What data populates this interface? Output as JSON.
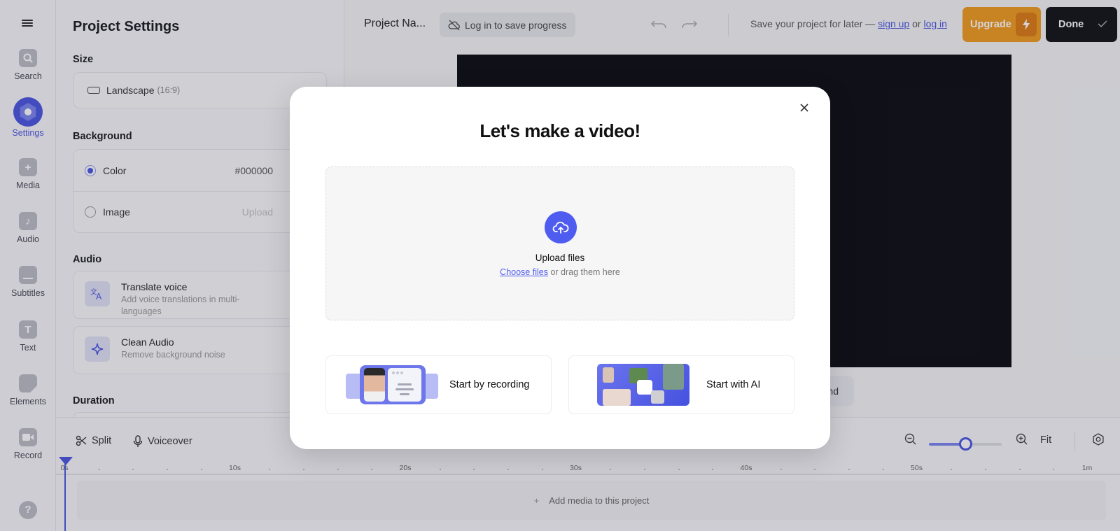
{
  "rail": {
    "menu_icon": "hamburger-icon",
    "items": [
      {
        "label": "Search",
        "icon": "search-icon",
        "active": false
      },
      {
        "label": "Settings",
        "icon": "settings-icon",
        "active": true
      },
      {
        "label": "Media",
        "icon": "plus-icon",
        "active": false
      },
      {
        "label": "Audio",
        "icon": "music-note-icon",
        "active": false
      },
      {
        "label": "Subtitles",
        "icon": "subtitles-icon",
        "active": false
      },
      {
        "label": "Text",
        "icon": "text-icon",
        "active": false
      },
      {
        "label": "Elements",
        "icon": "sticker-icon",
        "active": false
      },
      {
        "label": "Record",
        "icon": "camera-icon",
        "active": false
      }
    ],
    "help_label": "?"
  },
  "panel": {
    "title": "Project Settings",
    "size": {
      "heading": "Size",
      "value": "Landscape",
      "ratio": "(16:9)"
    },
    "background": {
      "heading": "Background",
      "options": [
        {
          "label": "Color",
          "value": "#000000",
          "selected": true
        },
        {
          "label": "Image",
          "value": "Upload",
          "selected": false
        }
      ]
    },
    "audio": {
      "heading": "Audio",
      "items": [
        {
          "title": "Translate voice",
          "description": "Add voice translations in multi-languages",
          "icon": "translate-icon"
        },
        {
          "title": "Clean Audio",
          "description": "Remove background noise",
          "icon": "sparkle-icon"
        }
      ]
    },
    "duration": {
      "heading": "Duration"
    }
  },
  "topbar": {
    "project_name": "Project Na...",
    "save_progress": "Log in to save progress",
    "save_later_prefix": "Save your project for later —",
    "sign_up": "sign up",
    "or": "or",
    "log_in": "log in",
    "upgrade": "Upgrade",
    "done": "Done"
  },
  "canvas": {
    "background_color": "#000000",
    "background_button_partial": "nd"
  },
  "bottom": {
    "split": "Split",
    "voiceover": "Voiceover",
    "fit": "Fit",
    "zoom_level": 0.5,
    "ruler_labels": [
      "0s",
      "10s",
      "20s",
      "30s",
      "40s",
      "50s",
      "1m"
    ],
    "add_media": "Add media to this project"
  },
  "modal": {
    "title": "Let's make a video!",
    "upload_title": "Upload files",
    "choose_files": "Choose files",
    "drag_text": "or drag them here",
    "option_record": "Start by recording",
    "option_ai": "Start with AI"
  },
  "colors": {
    "accent": "#4a55e0",
    "upgrade": "#f19a1c",
    "done": "#111115"
  }
}
